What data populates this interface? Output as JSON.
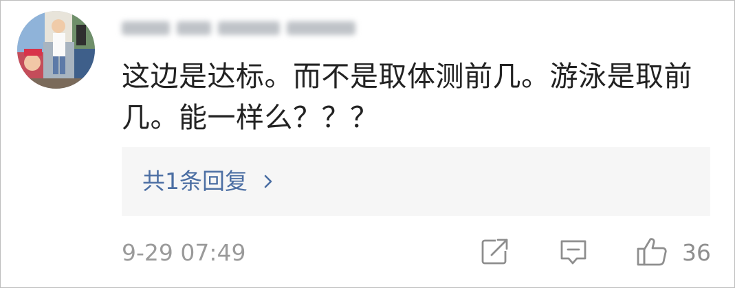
{
  "comment": {
    "username": "",
    "text": "这边是达标。而不是取体测前几。游泳是取前几。能一样么？？？",
    "reply_link_label": "共1条回复",
    "timestamp": "9-29 07:49",
    "like_count": "36"
  },
  "icons": {
    "avatar": "avatar-photo",
    "reply_chevron": "chevron-right-icon",
    "share": "share-icon",
    "comment": "comment-icon",
    "like": "thumbs-up-icon"
  },
  "colors": {
    "text": "#222222",
    "link": "#4b6ea3",
    "muted": "#9a9a9a",
    "reply_bg": "#f6f6f6"
  }
}
